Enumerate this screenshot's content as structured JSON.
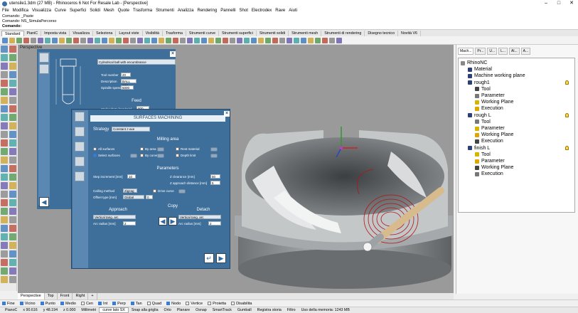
{
  "title": "utensile1.3dm (27 MB) - Rhinoceros 6 Not For Resale Lab - [Perspective]",
  "menu": [
    "File",
    "Modifica",
    "Visualizza",
    "Curve",
    "Superfici",
    "Solidi",
    "Mesh",
    "Quote",
    "Trasforma",
    "Strumenti",
    "Analizza",
    "Rendering",
    "Pannelli",
    "Shot",
    "Electrodex",
    "Rave",
    "Aiuti"
  ],
  "command_history": [
    "Comando: _Paste",
    "Comando: NS_SimulaPercorso"
  ],
  "command_prompt": "Comando:",
  "toolbar_tabs": [
    "Standard",
    "PianiC",
    "Imposta vista",
    "Visualizza",
    "Seleziona",
    "Layout viste",
    "Visibilità",
    "Trasforma",
    "Strumenti curve",
    "Strumenti superfici",
    "Strumenti solidi",
    "Strumenti mesh",
    "Strumenti di rendering",
    "Disegno tecnico",
    "Novità V6"
  ],
  "viewport_label": "Perspective",
  "view_tabs": [
    "Perspective",
    "Top",
    "Front",
    "Right",
    "+"
  ],
  "osnaps": [
    {
      "label": "Fine",
      "on": true
    },
    {
      "label": "Vicino",
      "on": true
    },
    {
      "label": "Punto",
      "on": true
    },
    {
      "label": "Medio",
      "on": true
    },
    {
      "label": "Cen",
      "on": false
    },
    {
      "label": "Int",
      "on": true
    },
    {
      "label": "Perp",
      "on": true
    },
    {
      "label": "Tan",
      "on": true
    },
    {
      "label": "Quad",
      "on": false
    },
    {
      "label": "Nodo",
      "on": true
    },
    {
      "label": "Vertice",
      "on": false
    },
    {
      "label": "Proietta",
      "on": false
    },
    {
      "label": "Disabilita",
      "on": false
    }
  ],
  "status": {
    "plane": "PianoC",
    "x": "x 90.616",
    "y": "y 48.194",
    "z": "z 0.000",
    "units": "Millimetri",
    "layer": "curve lato SX",
    "items": [
      "Snap alla griglia",
      "Orto",
      "Planare",
      "Osnap",
      "SmartTrack",
      "Gumball",
      "Registra storia",
      "Filtro",
      "Uso della memoria: 1243 MB"
    ]
  },
  "right_panel": {
    "tabs": [
      "Mach...",
      "Pr...",
      "U...",
      "L...",
      "Al...",
      "A..."
    ],
    "tree": [
      {
        "label": "RhinoNC",
        "level": 0,
        "bulb": false
      },
      {
        "label": "Material",
        "level": 1,
        "bulb": false
      },
      {
        "label": "Machine working plane",
        "level": 1,
        "bulb": false
      },
      {
        "label": "rough1",
        "level": 1,
        "bulb": true
      },
      {
        "label": "Tool",
        "level": 2,
        "bulb": false
      },
      {
        "label": "Parameter",
        "level": 2,
        "bulb": false
      },
      {
        "label": "Working Plane",
        "level": 2,
        "bulb": false
      },
      {
        "label": "Execution",
        "level": 2,
        "bulb": false
      },
      {
        "label": "rough L",
        "level": 1,
        "bulb": true
      },
      {
        "label": "Tool",
        "level": 2,
        "bulb": false
      },
      {
        "label": "Parameter",
        "level": 2,
        "bulb": false
      },
      {
        "label": "Working Plane",
        "level": 2,
        "bulb": false
      },
      {
        "label": "Execution",
        "level": 2,
        "bulb": false
      },
      {
        "label": "finish L",
        "level": 1,
        "bulb": true
      },
      {
        "label": "Tool",
        "level": 2,
        "bulb": false
      },
      {
        "label": "Parameter",
        "level": 2,
        "bulb": false
      },
      {
        "label": "Working Plane",
        "level": 2,
        "bulb": false
      },
      {
        "label": "Execution",
        "level": 2,
        "bulb": false
      }
    ]
  },
  "tool_dialog": {
    "tool_type": "Cylindrical ball with encumbrance",
    "tool_number_label": "Tool number",
    "tool_number": "20",
    "description_label": "Description",
    "description": "BALL 12H",
    "spindle_label": "Spindle speed",
    "spindle": "5000",
    "feed_title": "Feed",
    "xy_feed_label": "XY feedrate [mm/min]",
    "xy_feed": "800"
  },
  "surf_dialog": {
    "title": "SURFACES MACHINING",
    "strategy_label": "Strategy",
    "strategy": "Constant z-axe",
    "milling_area_title": "Milling area",
    "all_surfaces": "All surfaces",
    "select_surfaces": "Select surfaces",
    "by_area": "By area",
    "by_curve": "By curve",
    "rest_material": "Rest material",
    "depth_limit": "Depth limit",
    "parameters_title": "Parameters",
    "step_label": "Step increment [mm]",
    "step_value": "10",
    "z_clear_label": "Z clearance [mm]",
    "z_clear_value": "50",
    "z_app_label": "Z approach distance [mm]",
    "z_app_value": "5",
    "calling_label": "Calling method",
    "calling_value": "Zigzag",
    "drive_curve": "Drive curve",
    "offset_label": "Offset type [mm]",
    "offset_value": "Global",
    "offset_num": "0",
    "approach_title": "Approach",
    "copy_title": "Copy",
    "detach_title": "Detach",
    "approach_sel": "Vertical tang. arc",
    "detach_sel": "Vertical tang. arc",
    "arc_label": "Arc radius [mm]",
    "arc_value": "2",
    "arc_value2": "2"
  }
}
